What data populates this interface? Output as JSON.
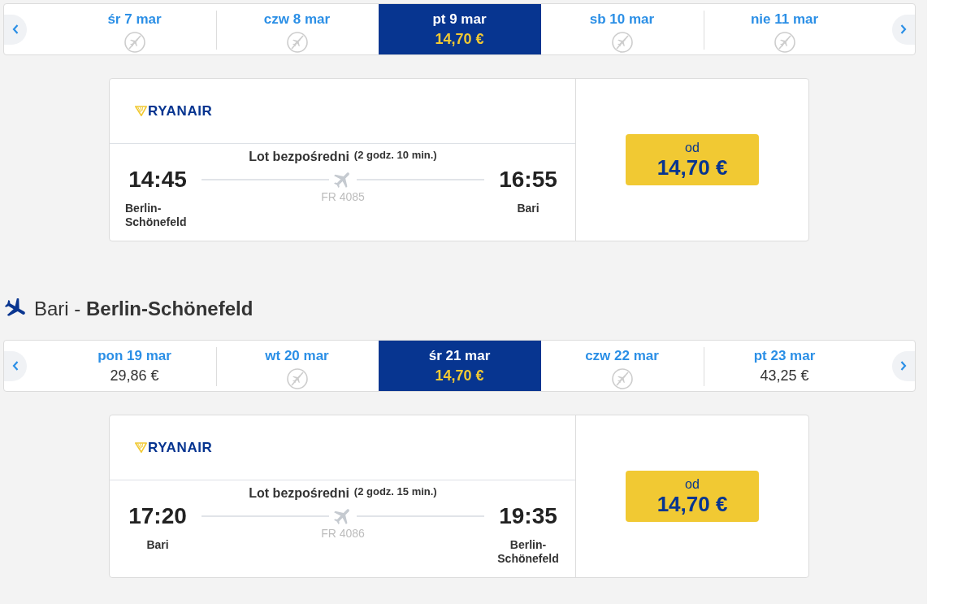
{
  "sections": [
    {
      "date_strip": {
        "days": [
          {
            "label": "śr 7 mar",
            "available": false,
            "selected": false
          },
          {
            "label": "czw 8 mar",
            "available": false,
            "selected": false
          },
          {
            "label": "pt 9 mar",
            "available": true,
            "price": "14,70 €",
            "selected": true
          },
          {
            "label": "sb 10 mar",
            "available": false,
            "selected": false
          },
          {
            "label": "nie 11 mar",
            "available": false,
            "selected": false
          }
        ]
      },
      "flight": {
        "airline": "RYANAIR",
        "type": "Lot bezpośredni",
        "duration": "(2 godz. 10 min.)",
        "departure": {
          "time": "14:45",
          "airport": "Berlin-Schönefeld"
        },
        "arrival": {
          "time": "16:55",
          "airport": "Bari"
        },
        "flight_number": "FR 4085",
        "price_label": "od",
        "price": "14,70 €"
      }
    },
    {
      "heading": "Bari - **Berlin-Schönefeld**",
      "date_strip": {
        "days": [
          {
            "label": "pon 19 mar",
            "available": true,
            "price": "29,86 €",
            "selected": false
          },
          {
            "label": "wt 20 mar",
            "available": false,
            "selected": false
          },
          {
            "label": "śr 21 mar",
            "available": true,
            "price": "14,70 €",
            "selected": true
          },
          {
            "label": "czw 22 mar",
            "available": false,
            "selected": false
          },
          {
            "label": "pt 23 mar",
            "available": true,
            "price": "43,25 €",
            "selected": false
          }
        ]
      },
      "flight": {
        "airline": "RYANAIR",
        "type": "Lot bezpośredni",
        "duration": "(2 godz. 15 min.)",
        "departure": {
          "time": "17:20",
          "airport": "Bari"
        },
        "arrival": {
          "time": "19:35",
          "airport": "Berlin-Schönefeld"
        },
        "flight_number": "FR 4086",
        "price_label": "od",
        "price": "14,70 €"
      }
    }
  ]
}
